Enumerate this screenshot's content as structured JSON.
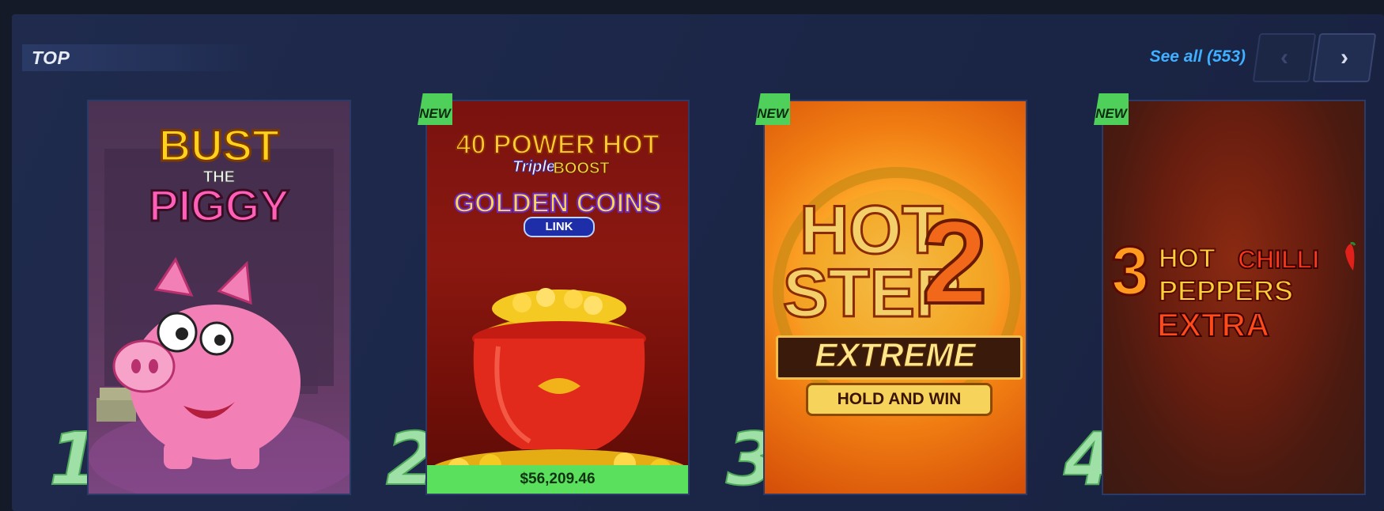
{
  "section": {
    "title": "TOP",
    "see_all_label": "See all (553)",
    "prev_icon": "‹",
    "next_icon": "›"
  },
  "games": [
    {
      "rank": "1",
      "is_new": false,
      "title_lines": [
        "BUST",
        "THE",
        "PIGGY"
      ],
      "jackpot": null
    },
    {
      "rank": "2",
      "is_new": true,
      "badge": "NEW",
      "title_lines": [
        "40 POWER HOT",
        "Triple",
        "BOOST",
        "GOLDEN COINS",
        "LINK"
      ],
      "jackpot": "$56,209.46"
    },
    {
      "rank": "3",
      "is_new": true,
      "badge": "NEW",
      "title_lines": [
        "HOT",
        "STEP",
        "2",
        "EXTREME",
        "HOLD AND WIN"
      ],
      "jackpot": null
    },
    {
      "rank": "4",
      "is_new": true,
      "badge": "NEW",
      "title_lines": [
        "3",
        "HOT",
        "CHILLI",
        "PEPPERS",
        "EXTRA"
      ],
      "jackpot": null
    }
  ],
  "colors": {
    "accent_link": "#3fb0ff",
    "new_badge": "#4ed05a",
    "rank_number": "#9fe0a6",
    "jackpot_bar": "#5ae05c"
  }
}
